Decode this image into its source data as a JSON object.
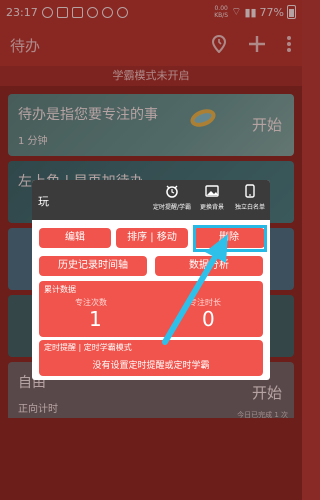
{
  "status": {
    "time": "23:17",
    "netspeed": "0.00\nKB/S",
    "battery": "77%"
  },
  "appbar": {
    "title": "待办",
    "icons": [
      "timer-icon",
      "plus-icon",
      "more-icon"
    ]
  },
  "banner": "学霸模式未开启",
  "cards": [
    {
      "title": "待办是指您要专注的事",
      "sub": "1 分钟",
      "button": "开始"
    },
    {
      "title": "左上角 | 早再加待办",
      "sub": "",
      "button": ""
    },
    {
      "title": "",
      "sub": "",
      "button": ""
    },
    {
      "title": "",
      "sub": "",
      "button": ""
    },
    {
      "title": "自由",
      "sub": "正向计时",
      "button": "开始",
      "foot": "今日已完成 1 次"
    }
  ],
  "panel": {
    "title": "玩",
    "header_items": [
      {
        "icon": "alarm-clock-icon",
        "label": "定时提醒/学霸"
      },
      {
        "icon": "image-icon",
        "label": "更换背景"
      },
      {
        "icon": "phone-icon",
        "label": "独立白名单"
      }
    ],
    "buttons": {
      "edit": "编辑",
      "sort": "排序 | 移动",
      "delete": "删除",
      "history": "历史记录时间轴",
      "data": "数据分析"
    },
    "stats": {
      "header": "累计数据",
      "count_label": "专注次数",
      "count_value": "1",
      "duration_label": "专注时长",
      "duration_value": "0"
    },
    "timer": {
      "header": "定时提醒 | 定时学霸模式",
      "text": "没有设置定时提醒或定时学霸"
    }
  }
}
